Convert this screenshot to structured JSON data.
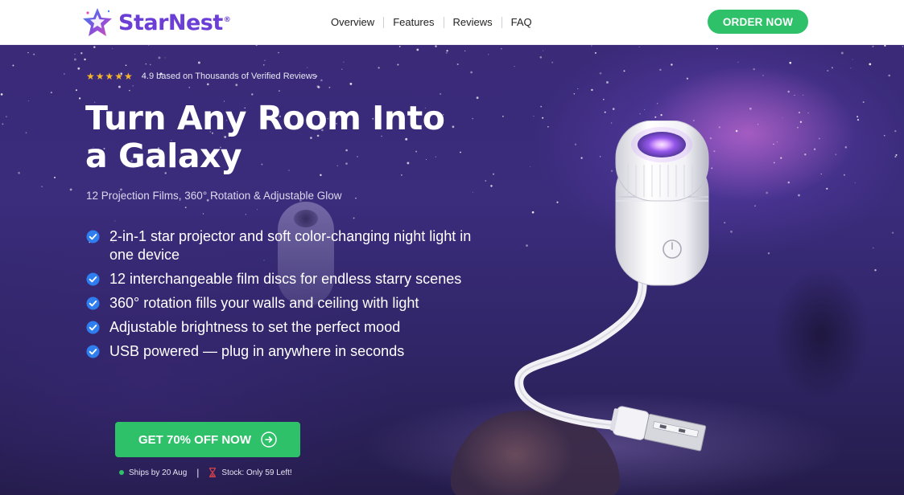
{
  "brand": {
    "name": "StarNest",
    "mark": "®",
    "colors": {
      "primary": "#6b3fd6",
      "accent_green": "#2ec16a",
      "star_gold": "#f7b52c"
    }
  },
  "nav": {
    "items": [
      {
        "label": "Overview"
      },
      {
        "label": "Features"
      },
      {
        "label": "Reviews"
      },
      {
        "label": "FAQ"
      }
    ]
  },
  "header_cta": {
    "label": "ORDER NOW"
  },
  "hero": {
    "rating_stars": "★★★★★",
    "rating_text": "4.9 based on Thousands of Verified Reviews",
    "headline_line1": "Turn Any Room Into",
    "headline_line2": "a Galaxy",
    "subhead": "12 Projection Films, 360° Rotation & Adjustable Glow",
    "features": [
      {
        "text": "2-in-1 star projector and soft color-changing night light in one device",
        "icon": "check-circle-icon"
      },
      {
        "text": "12 interchangeable film discs for endless starry scenes",
        "icon": "check-circle-icon"
      },
      {
        "text": "360° rotation fills your walls and ceiling with light",
        "icon": "check-circle-icon"
      },
      {
        "text": "Adjustable brightness to set the perfect mood",
        "icon": "check-circle-icon"
      },
      {
        "text": "USB powered — plug in anywhere in seconds",
        "icon": "check-circle-icon"
      }
    ],
    "cta": {
      "label": "GET 70% OFF NOW",
      "icon": "arrow-right-circle-icon"
    },
    "shipping": {
      "ship_text": "Ships by 20 Aug",
      "separator": "|",
      "stock_text": "Stock: Only 59 Left!"
    }
  }
}
